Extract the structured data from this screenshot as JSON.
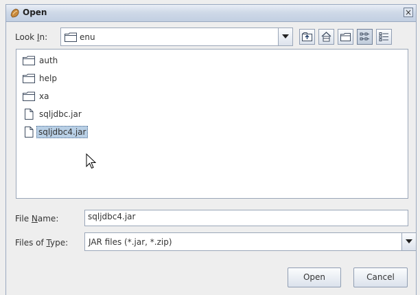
{
  "window": {
    "title": "Open",
    "close_glyph": "×"
  },
  "look_in": {
    "label": "Look In:",
    "mnemonic_prefix": "Look ",
    "mnemonic_char": "I",
    "mnemonic_suffix": "n:",
    "value": "enu",
    "folder_icon": "folder-icon"
  },
  "toolbar": {
    "buttons": [
      {
        "name": "up-one-level-button",
        "icon": "up-folder-icon"
      },
      {
        "name": "home-button",
        "icon": "home-icon"
      },
      {
        "name": "new-folder-button",
        "icon": "new-folder-icon"
      },
      {
        "name": "list-view-button",
        "icon": "list-view-icon",
        "pressed": true
      },
      {
        "name": "details-view-button",
        "icon": "details-view-icon"
      }
    ]
  },
  "files": [
    {
      "name": "auth",
      "type": "folder"
    },
    {
      "name": "help",
      "type": "folder"
    },
    {
      "name": "xa",
      "type": "folder"
    },
    {
      "name": "sqljdbc.jar",
      "type": "file"
    },
    {
      "name": "sqljdbc4.jar",
      "type": "file",
      "selected": true
    }
  ],
  "file_name": {
    "label_prefix": "File ",
    "label_mnemonic": "N",
    "label_suffix": "ame:",
    "value": "sqljdbc4.jar"
  },
  "file_type": {
    "label_prefix": "Files of ",
    "label_mnemonic": "T",
    "label_suffix": "ype:",
    "value": "JAR files (*.jar, *.zip)"
  },
  "buttons": {
    "open": "Open",
    "cancel": "Cancel"
  },
  "colors": {
    "selection": "#b8cfe5",
    "titlebar": "#cfd9e8",
    "background": "#eeeeee"
  }
}
